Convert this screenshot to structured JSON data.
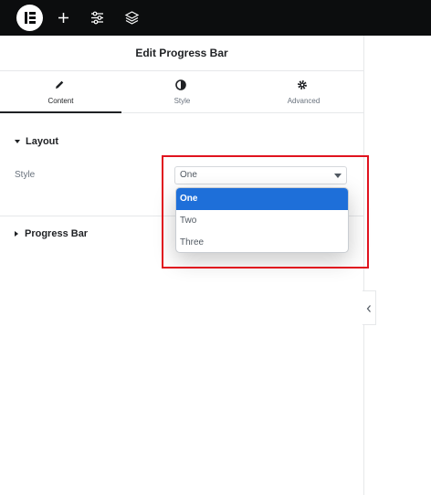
{
  "topbar": {
    "icons": [
      "elementor-logo-icon",
      "plus-icon",
      "sliders-icon",
      "layers-icon"
    ]
  },
  "panel": {
    "title": "Edit Progress Bar",
    "tabs": [
      {
        "label": "Content",
        "icon": "pencil-icon",
        "active": true
      },
      {
        "label": "Style",
        "icon": "half-circle-icon",
        "active": false
      },
      {
        "label": "Advanced",
        "icon": "gear-icon",
        "active": false
      }
    ],
    "sections": [
      {
        "title": "Layout",
        "expanded": true
      },
      {
        "title": "Progress Bar",
        "expanded": false
      }
    ],
    "style_control": {
      "label": "Style",
      "value": "One",
      "options": [
        "One",
        "Two",
        "Three"
      ],
      "highlighted_option": "One"
    }
  },
  "colors": {
    "topbar": "#0c0d0e",
    "selected_option": "#1e6fd9",
    "highlight_box": "#e0131f"
  }
}
